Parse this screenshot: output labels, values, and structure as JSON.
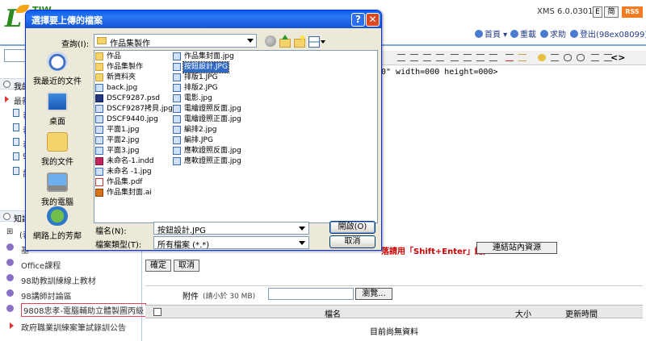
{
  "app": {
    "logo_text": "TIW",
    "version": "XMS 6.0.0301C",
    "header_buttons": [
      "E",
      "简",
      "RSS"
    ],
    "links": {
      "home": "首頁",
      "reload": "重載",
      "help": "求助",
      "logout": "登出(98ex08099)"
    }
  },
  "sidebar": {
    "section1": "我的",
    "subsection": "最新",
    "partial_items": [
      "表",
      "表",
      "表",
      "98",
      "計"
    ],
    "section2": "知識",
    "expand_item": "(表",
    "items": [
      "基",
      "Office課程",
      "98助教訓練線上教材",
      "98講師討論區",
      "9808忠孝-電腦輔助立體製圖丙級",
      "政府職業訓練案筆試錄訓公告"
    ]
  },
  "editor": {
    "code": "0\" width=000 height=000>",
    "hint": "落請用「Shift+Enter」鍵)",
    "link_button": "連結站內資源",
    "confirm": "確定",
    "cancel": "取消",
    "attachment_label": "附件",
    "attachment_note": "(請小於 30 MB)",
    "browse": "瀏覽...",
    "table_headers": [
      "檔名",
      "大小",
      "更新時間"
    ],
    "empty": "目前尚無資料"
  },
  "dialog": {
    "title": "選擇要上傳的檔案",
    "help_glyph": "?",
    "close_glyph": "✕",
    "lookin_label": "查詢(I):",
    "lookin_value": "作品集製作",
    "places": [
      "我最近的文件",
      "桌面",
      "我的文件",
      "我的電腦",
      "網路上的芳鄰"
    ],
    "files_col1": [
      {
        "name": "作品",
        "type": "folder"
      },
      {
        "name": "作品集製作",
        "type": "folder"
      },
      {
        "name": "新資料夾",
        "type": "folder"
      },
      {
        "name": "back.jpg",
        "type": "img"
      },
      {
        "name": "DSCF9287.psd",
        "type": "psd"
      },
      {
        "name": "DSCF9287拷貝.jpg",
        "type": "img"
      },
      {
        "name": "DSCF9440.jpg",
        "type": "img"
      },
      {
        "name": "平面1.jpg",
        "type": "img"
      },
      {
        "name": "平面2.jpg",
        "type": "img"
      },
      {
        "name": "平面3.jpg",
        "type": "img"
      },
      {
        "name": "未命名-1.indd",
        "type": "indd"
      },
      {
        "name": "未命名 -1.jpg",
        "type": "img"
      },
      {
        "name": "作品集.pdf",
        "type": "pdf"
      },
      {
        "name": "作品集封面.ai",
        "type": "ai"
      }
    ],
    "files_col2": [
      {
        "name": "作品集封面.jpg",
        "type": "img"
      },
      {
        "name": "按鈕設計.JPG",
        "type": "img",
        "selected": true
      },
      {
        "name": "排版1.JPG",
        "type": "img"
      },
      {
        "name": "排版2.JPG",
        "type": "img"
      },
      {
        "name": "電影.jpg",
        "type": "img"
      },
      {
        "name": "電繪證照反面.jpg",
        "type": "img"
      },
      {
        "name": "電繪證照正面.jpg",
        "type": "img"
      },
      {
        "name": "編排2.jpg",
        "type": "img"
      },
      {
        "name": "編排.JPG",
        "type": "img"
      },
      {
        "name": "應軟證照反面.jpg",
        "type": "img"
      },
      {
        "name": "應軟證照正面.jpg",
        "type": "img"
      }
    ],
    "filename_label": "檔名(N):",
    "filename_value": "按鈕設計.JPG",
    "filetype_label": "檔案類型(T):",
    "filetype_value": "所有檔案 (*.*)",
    "open_button": "開啟(O)",
    "cancel_button": "取消"
  }
}
